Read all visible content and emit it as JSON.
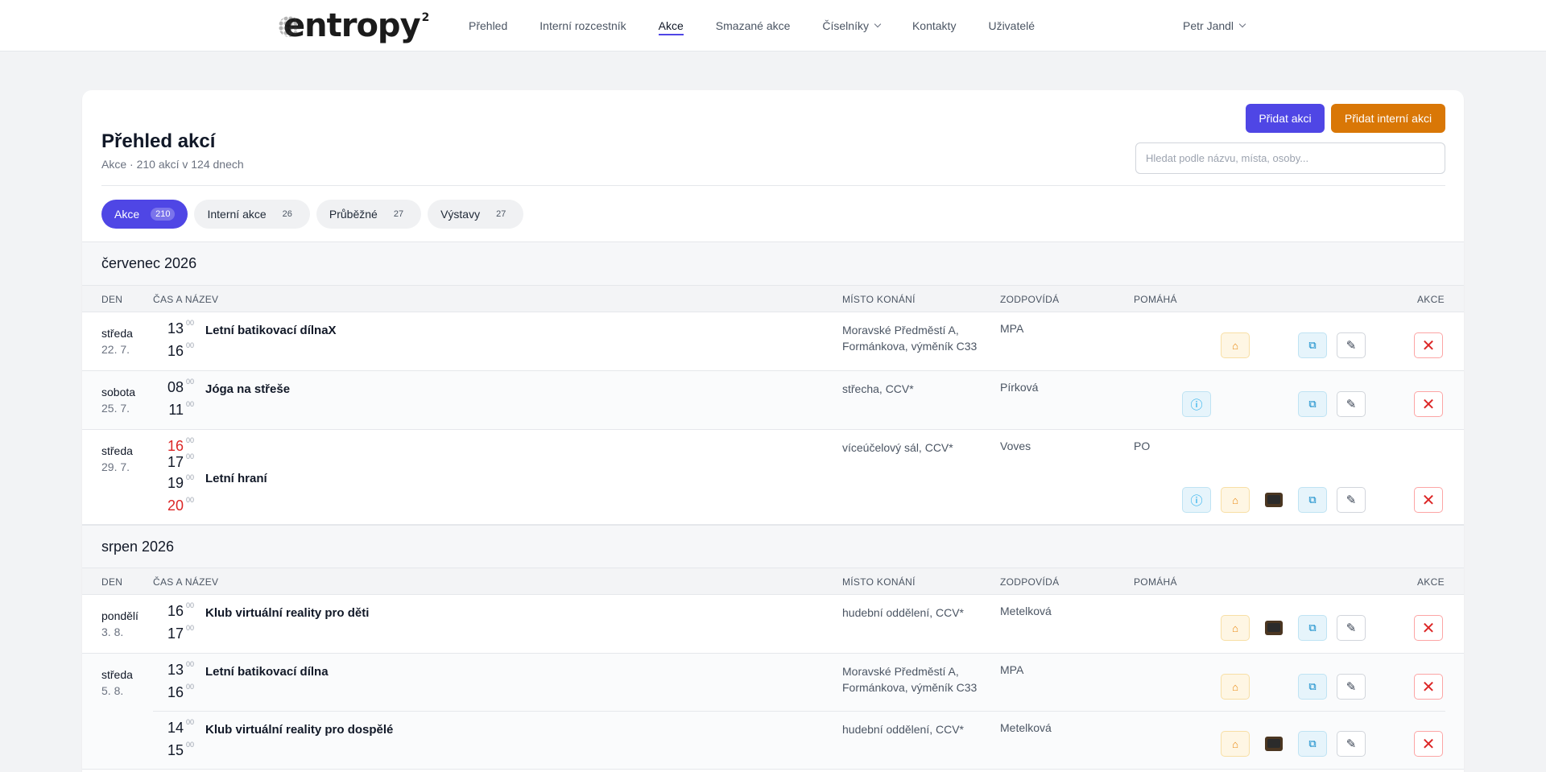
{
  "logo": {
    "text": "entropy",
    "sup": "2"
  },
  "nav": {
    "items": [
      "Přehled",
      "Interní rozcestník",
      "Akce",
      "Smazané akce",
      "Číselníky",
      "Kontakty",
      "Uživatelé"
    ],
    "active": "Akce",
    "user": "Petr Jandl"
  },
  "header": {
    "title": "Přehled akcí",
    "subtitle": "Akce · 210 akcí v 124 dnech",
    "add_label": "Přidat akci",
    "add_internal_label": "Přidat interní akci",
    "search_placeholder": "Hledat podle názvu, místa, osoby..."
  },
  "tabs": [
    {
      "label": "Akce",
      "count": "210"
    },
    {
      "label": "Interní akce",
      "count": "26"
    },
    {
      "label": "Průběžné",
      "count": "27"
    },
    {
      "label": "Výstavy",
      "count": "27"
    }
  ],
  "columns": {
    "day": "DEN",
    "time": "ČAS A NÁZEV",
    "place": "MÍSTO KONÁNÍ",
    "resp": "ZODPOVÍDÁ",
    "help": "POMÁHÁ",
    "actions": "AKCE"
  },
  "months": [
    {
      "name": "červenec 2026",
      "rows": [
        {
          "day": "středa",
          "date": "22. 7.",
          "title": "Letní batikovací dílnaX",
          "place": "Moravské Předměstí A, Formánkova, výměník C33",
          "resp": "MPA",
          "help": "",
          "times": [
            {
              "h": "13",
              "m": "00"
            },
            {
              "h": "16",
              "m": "00"
            }
          ]
        },
        {
          "day": "sobota",
          "date": "25. 7.",
          "title": "Jóga na střeše",
          "place": "střecha, CCV*",
          "resp": "Pírková",
          "help": "",
          "times": [
            {
              "h": "08",
              "m": "00"
            },
            {
              "h": "11",
              "m": "00"
            }
          ]
        },
        {
          "day": "středa",
          "date": "29. 7.",
          "title": "Letní hraní",
          "place": "víceúčelový sál, CCV*",
          "resp": "Voves",
          "help": "PO",
          "times": [
            {
              "h": "16",
              "m": "00"
            },
            {
              "h": "17",
              "m": "00"
            },
            {
              "h": "19",
              "m": "00"
            },
            {
              "h": "20",
              "m": "00"
            }
          ]
        }
      ]
    },
    {
      "name": "srpen 2026",
      "rows": [
        {
          "day": "pondělí",
          "date": "3. 8.",
          "title": "Klub virtuální reality pro děti",
          "place": "hudební oddělení, CCV*",
          "resp": "Metelková",
          "help": "",
          "times": [
            {
              "h": "16",
              "m": "00"
            },
            {
              "h": "17",
              "m": "00"
            }
          ]
        },
        {
          "day": "středa",
          "date": "5. 8.",
          "title": "Letní batikovací dílna",
          "place": "Moravské Předměstí A, Formánkova, výměník C33",
          "resp": "MPA",
          "help": "",
          "times": [
            {
              "h": "13",
              "m": "00"
            },
            {
              "h": "16",
              "m": "00"
            }
          ]
        },
        {
          "day": "",
          "date": "",
          "title": "Klub virtuální reality pro dospělé",
          "place": "hudební oddělení, CCV*",
          "resp": "Metelková",
          "help": "",
          "times": [
            {
              "h": "14",
              "m": "00"
            },
            {
              "h": "15",
              "m": "00"
            }
          ]
        }
      ]
    }
  ],
  "icons": {
    "info": "ⓘ",
    "cake": "⌂",
    "copy": "⧉",
    "edit": "✎",
    "delete": "✕"
  },
  "colors": {
    "primary": "#4f46e5",
    "orange": "#d97706",
    "danger": "#dc2626"
  }
}
